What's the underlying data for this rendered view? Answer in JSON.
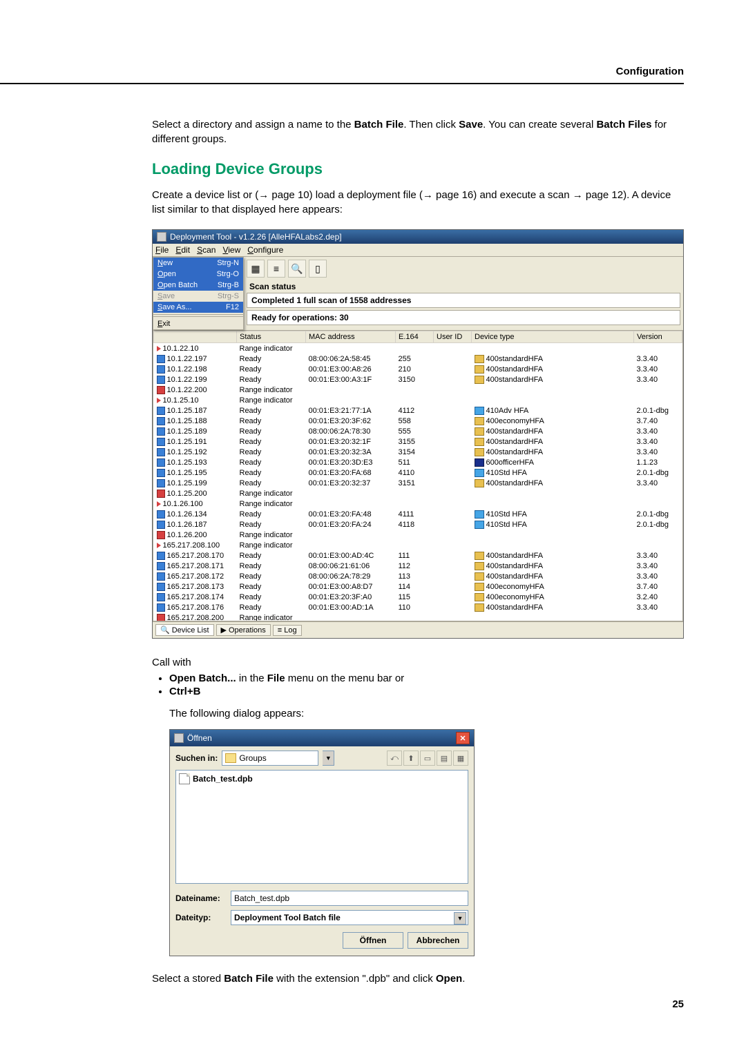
{
  "header": {
    "section": "Configuration"
  },
  "intro1_a": "Select a directory and assign a name to the ",
  "intro1_b": "Batch File",
  "intro1_c": ". Then click ",
  "intro1_d": "Save",
  "intro2_a": ". You can create several ",
  "intro2_b": "Batch Files",
  "intro2_c": " for different groups.",
  "h2": "Loading Device Groups",
  "p2_a": "Create a device list or (",
  "p2_b": " page 10) load a deployment file (",
  "p2_c": " page 16) and execute a scan ",
  "p2_d": " page 12). A device list similar to that displayed here appears:",
  "win1": {
    "title": "Deployment Tool - v1.2.26  [AlleHFALabs2.dep]",
    "menus": [
      "File",
      "Edit",
      "Scan",
      "View",
      "Configure"
    ],
    "dropdown": [
      {
        "label": "New",
        "accel": "Strg-N",
        "cls": "highlight"
      },
      {
        "label": "Open",
        "accel": "Strg-O",
        "cls": "highlight"
      },
      {
        "label": "Open Batch",
        "accel": "Strg-B",
        "cls": "highlight"
      },
      {
        "label": "Save",
        "accel": "Strg-S",
        "cls": "disabled"
      },
      {
        "label": "Save As...",
        "accel": "F12",
        "cls": "highlight"
      },
      {
        "label": "Exit",
        "accel": "",
        "cls": ""
      }
    ],
    "scan_status_label": "Scan status",
    "scan_msg1": "Completed 1 full scan of 1558 addresses",
    "scan_msg2": "Ready for operations: 30",
    "columns": [
      "",
      "Status",
      "MAC address",
      "E.164",
      "User ID",
      "Device type",
      "Version"
    ],
    "rows": [
      {
        "icon": "arrow",
        "ip": "10.1.22.10",
        "status": "Range indicator"
      },
      {
        "icon": "blue",
        "ip": "10.1.22.197",
        "status": "Ready",
        "mac": "08:00:06:2A:58:45",
        "e164": "255",
        "dtype": "400standardHFA",
        "dico": "std",
        "ver": "3.3.40"
      },
      {
        "icon": "blue",
        "ip": "10.1.22.198",
        "status": "Ready",
        "mac": "00:01:E3:00:A8:26",
        "e164": "210",
        "dtype": "400standardHFA",
        "dico": "std",
        "ver": "3.3.40"
      },
      {
        "icon": "blue",
        "ip": "10.1.22.199",
        "status": "Ready",
        "mac": "00:01:E3:00:A3:1F",
        "e164": "3150",
        "dtype": "400standardHFA",
        "dico": "std",
        "ver": "3.3.40"
      },
      {
        "icon": "red",
        "ip": "10.1.22.200",
        "status": "Range indicator"
      },
      {
        "icon": "arrow",
        "ip": "10.1.25.10",
        "status": "Range indicator"
      },
      {
        "icon": "blue",
        "ip": "10.1.25.187",
        "status": "Ready",
        "mac": "00:01:E3:21:77:1A",
        "e164": "4112",
        "dtype": "410Adv HFA",
        "dico": "adv",
        "ver": "2.0.1-dbg"
      },
      {
        "icon": "blue",
        "ip": "10.1.25.188",
        "status": "Ready",
        "mac": "00:01:E3:20:3F:62",
        "e164": "558",
        "dtype": "400economyHFA",
        "dico": "std",
        "ver": "3.7.40"
      },
      {
        "icon": "blue",
        "ip": "10.1.25.189",
        "status": "Ready",
        "mac": "08:00:06:2A:78:30",
        "e164": "555",
        "dtype": "400standardHFA",
        "dico": "std",
        "ver": "3.3.40"
      },
      {
        "icon": "blue",
        "ip": "10.1.25.191",
        "status": "Ready",
        "mac": "00:01:E3:20:32:1F",
        "e164": "3155",
        "dtype": "400standardHFA",
        "dico": "std",
        "ver": "3.3.40"
      },
      {
        "icon": "blue",
        "ip": "10.1.25.192",
        "status": "Ready",
        "mac": "00:01:E3:20:32:3A",
        "e164": "3154",
        "dtype": "400standardHFA",
        "dico": "std",
        "ver": "3.3.40"
      },
      {
        "icon": "blue",
        "ip": "10.1.25.193",
        "status": "Ready",
        "mac": "00:01:E3:20:3D:E3",
        "e164": "511",
        "dtype": "600officerHFA",
        "dico": "off",
        "ver": "1.1.23"
      },
      {
        "icon": "blue",
        "ip": "10.1.25.195",
        "status": "Ready",
        "mac": "00:01:E3:20:FA:68",
        "e164": "4110",
        "dtype": "410Std HFA",
        "dico": "adv",
        "ver": "2.0.1-dbg"
      },
      {
        "icon": "blue",
        "ip": "10.1.25.199",
        "status": "Ready",
        "mac": "00:01:E3:20:32:37",
        "e164": "3151",
        "dtype": "400standardHFA",
        "dico": "std",
        "ver": "3.3.40"
      },
      {
        "icon": "red",
        "ip": "10.1.25.200",
        "status": "Range indicator"
      },
      {
        "icon": "arrow",
        "ip": "10.1.26.100",
        "status": "Range indicator"
      },
      {
        "icon": "blue",
        "ip": "10.1.26.134",
        "status": "Ready",
        "mac": "00:01:E3:20:FA:48",
        "e164": "4111",
        "dtype": "410Std HFA",
        "dico": "adv",
        "ver": "2.0.1-dbg"
      },
      {
        "icon": "blue",
        "ip": "10.1.26.187",
        "status": "Ready",
        "mac": "00:01:E3:20:FA:24",
        "e164": "4118",
        "dtype": "410Std HFA",
        "dico": "adv",
        "ver": "2.0.1-dbg"
      },
      {
        "icon": "red",
        "ip": "10.1.26.200",
        "status": "Range indicator"
      },
      {
        "icon": "arrow",
        "ip": "165.217.208.100",
        "status": "Range indicator"
      },
      {
        "icon": "blue",
        "ip": "165.217.208.170",
        "status": "Ready",
        "mac": "00:01:E3:00:AD:4C",
        "e164": "111",
        "dtype": "400standardHFA",
        "dico": "std",
        "ver": "3.3.40"
      },
      {
        "icon": "blue",
        "ip": "165.217.208.171",
        "status": "Ready",
        "mac": "08:00:06:21:61:06",
        "e164": "112",
        "dtype": "400standardHFA",
        "dico": "std",
        "ver": "3.3.40"
      },
      {
        "icon": "blue",
        "ip": "165.217.208.172",
        "status": "Ready",
        "mac": "08:00:06:2A:78:29",
        "e164": "113",
        "dtype": "400standardHFA",
        "dico": "std",
        "ver": "3.3.40"
      },
      {
        "icon": "blue",
        "ip": "165.217.208.173",
        "status": "Ready",
        "mac": "00:01:E3:00:A8:D7",
        "e164": "114",
        "dtype": "400economyHFA",
        "dico": "std",
        "ver": "3.7.40"
      },
      {
        "icon": "blue",
        "ip": "165.217.208.174",
        "status": "Ready",
        "mac": "00:01:E3:20:3F:A0",
        "e164": "115",
        "dtype": "400economyHFA",
        "dico": "std",
        "ver": "3.2.40"
      },
      {
        "icon": "blue",
        "ip": "165.217.208.176",
        "status": "Ready",
        "mac": "00:01:E3:00:AD:1A",
        "e164": "110",
        "dtype": "400standardHFA",
        "dico": "std",
        "ver": "3.3.40"
      },
      {
        "icon": "red",
        "ip": "165.217.208.200",
        "status": "Range indicator"
      }
    ],
    "tabs": [
      "Device List",
      "Operations",
      "Log"
    ]
  },
  "call_with": "Call with",
  "bullet1_a": "Open Batch...",
  "bullet1_b": " in the ",
  "bullet1_c": "File",
  "bullet1_d": " menu on the menu bar or",
  "bullet2": "Ctrl+B",
  "dialog_appears": "The following dialog appears:",
  "win2": {
    "title": "Öffnen",
    "lookin_label": "Suchen in:",
    "folder": "Groups",
    "file": "Batch_test.dpb",
    "filename_label": "Dateiname:",
    "filename_value": "Batch_test.dpb",
    "filetype_label": "Dateityp:",
    "filetype_value": "Deployment Tool Batch file",
    "open_btn": "Öffnen",
    "cancel_btn": "Abbrechen"
  },
  "final_a": "Select a stored ",
  "final_b": "Batch File",
  "final_c": " with the extension \".dpb\" and click ",
  "final_d": "Open",
  "final_e": ".",
  "page_num": "25"
}
